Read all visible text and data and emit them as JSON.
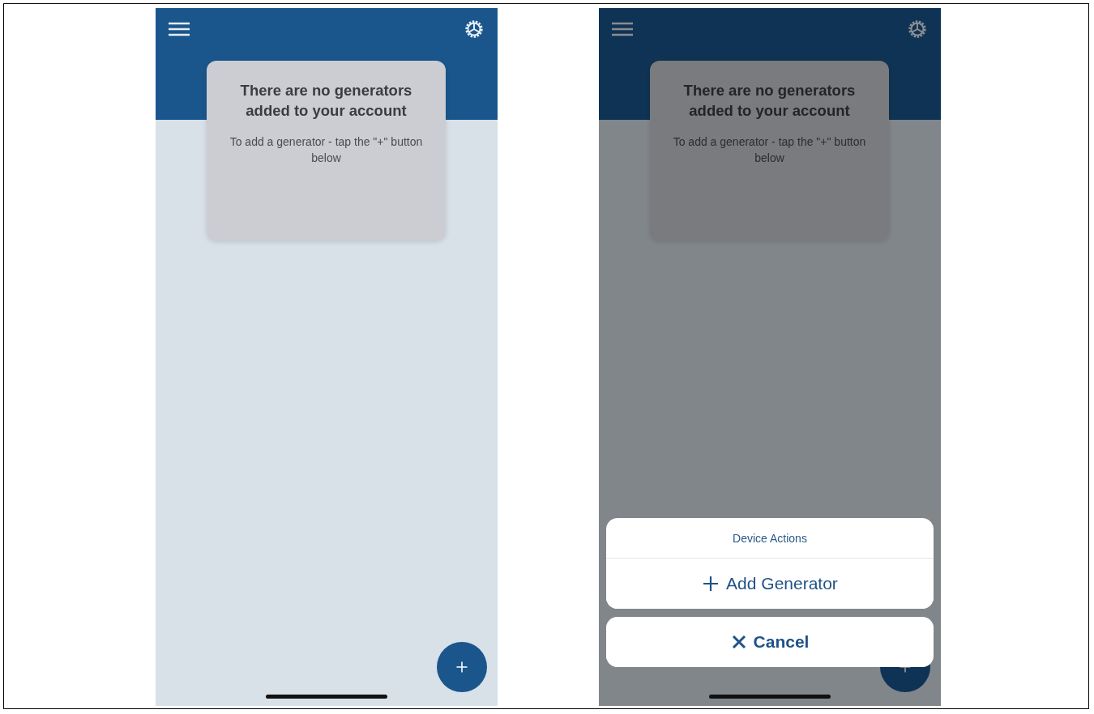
{
  "screens": [
    {
      "dimmed": false,
      "empty_state": {
        "title": "There are no generators added to your account",
        "message": "To add a generator - tap the \"+\" button below"
      }
    },
    {
      "dimmed": true,
      "empty_state": {
        "title": "There are no generators added to your account",
        "message": "To add a generator - tap the \"+\" button below"
      },
      "action_sheet": {
        "title": "Device Actions",
        "actions": [
          {
            "kind": "add",
            "label": "Add Generator"
          }
        ],
        "cancel": "Cancel"
      }
    }
  ]
}
